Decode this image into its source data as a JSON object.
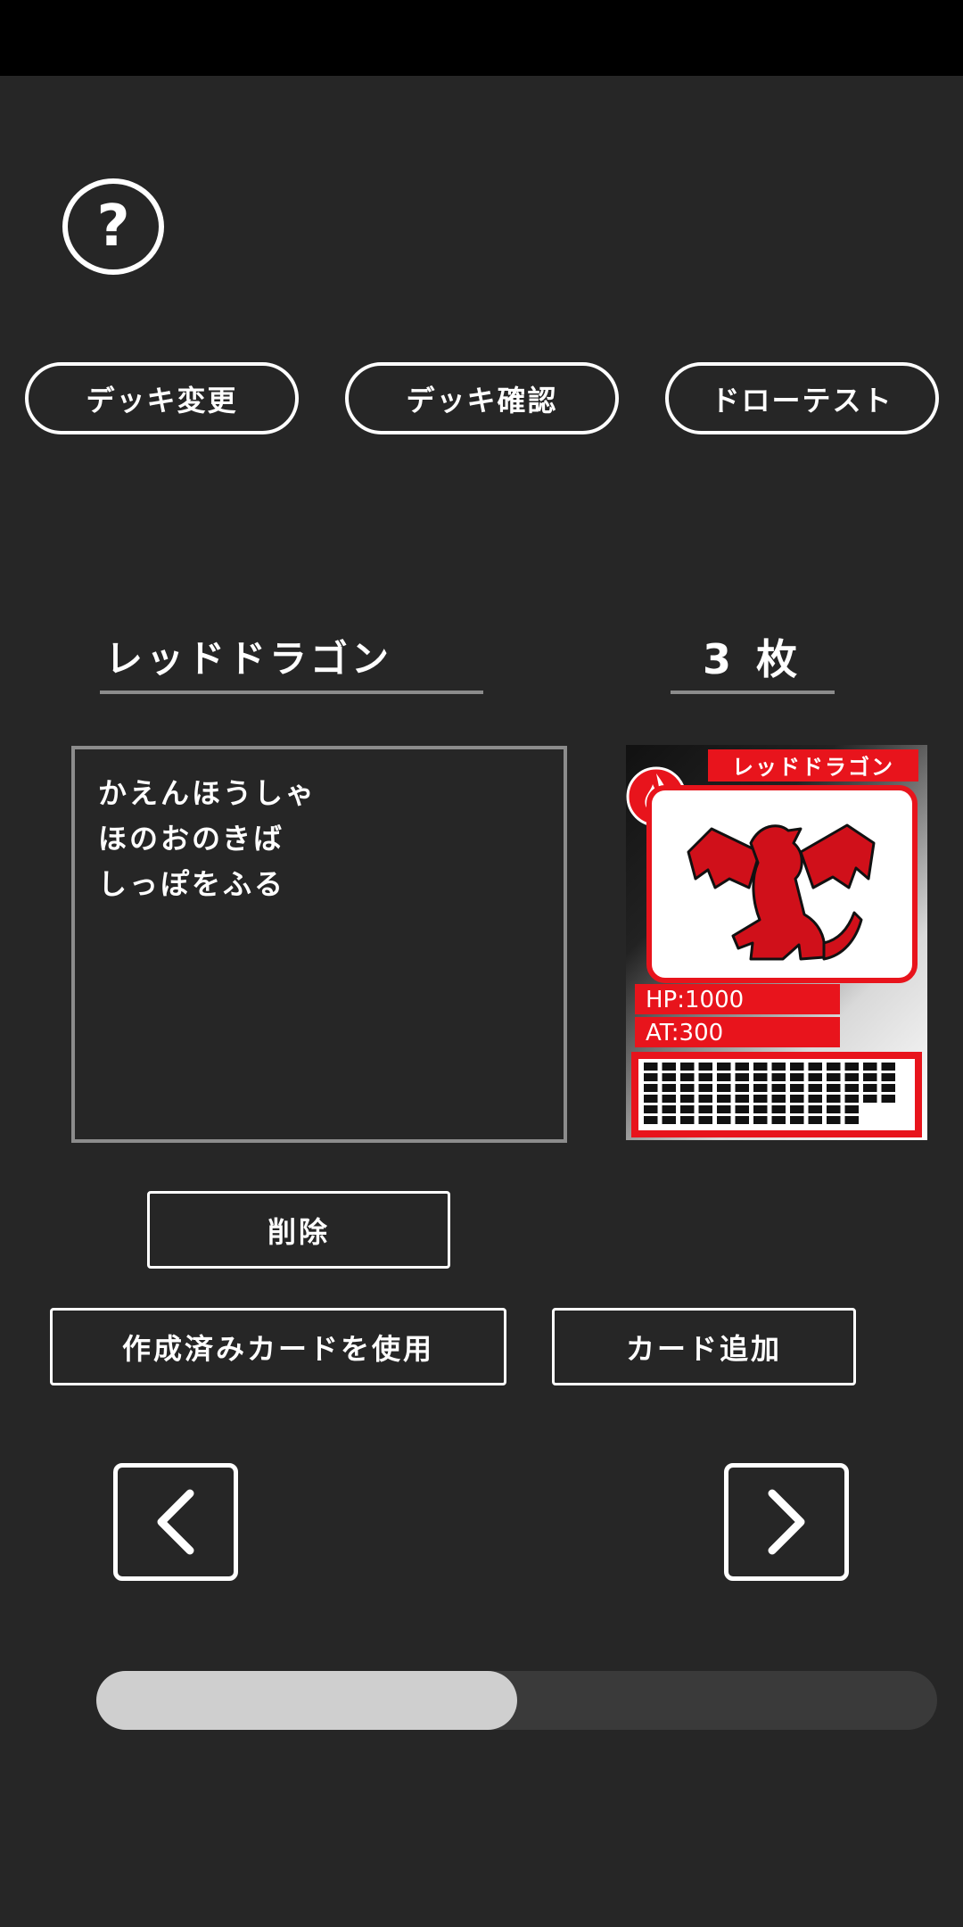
{
  "help": {
    "icon": "question-circle-icon",
    "glyph": "?"
  },
  "tabs": [
    {
      "label": "デッキ変更"
    },
    {
      "label": "デッキ確認"
    },
    {
      "label": "ドローテスト"
    }
  ],
  "card": {
    "name": "レッドドラゴン",
    "count": "3 枚",
    "moves": [
      "かえんほうしゃ",
      "ほのおのきば",
      "しっぽをふる"
    ],
    "preview": {
      "name": "レッドドラゴン",
      "hp": "HP:1000",
      "at": "AT:300",
      "element_icon": "flame-icon",
      "accent_color": "#e8141c"
    }
  },
  "actions": {
    "delete_label": "削除",
    "use_created_label": "作成済みカードを使用",
    "add_card_label": "カード追加"
  },
  "nav": {
    "prev_icon": "chevron-left-icon",
    "next_icon": "chevron-right-icon"
  },
  "scroll": {
    "position_fraction": 0.5
  }
}
